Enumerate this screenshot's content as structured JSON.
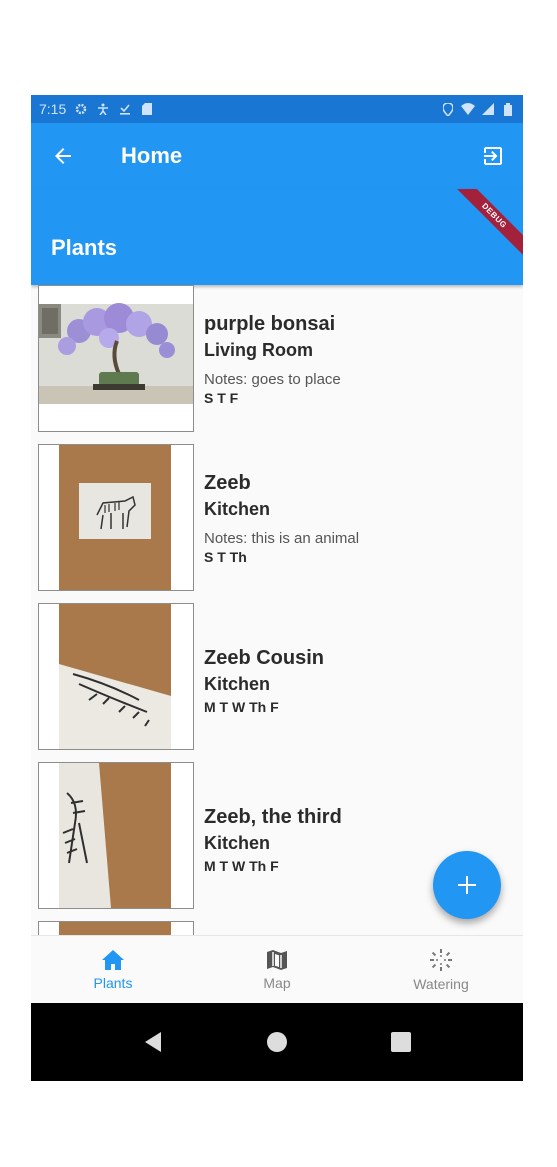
{
  "status_bar": {
    "time": "7:15",
    "icons": [
      "settings-icon",
      "accessibility-icon",
      "download-done-icon",
      "sd-card-icon",
      "location-icon",
      "wifi-icon",
      "signal-icon",
      "battery-icon"
    ]
  },
  "app_bar": {
    "title": "Home",
    "back_icon": "arrow-back-icon",
    "action_icon": "logout-icon"
  },
  "header": {
    "title": "Plants",
    "debug_label": "DEBUG"
  },
  "plants": [
    {
      "name": "purple bonsai",
      "room": "Living Room",
      "notes": "Notes: goes to place",
      "days": "S T F",
      "image": "bonsai-photo"
    },
    {
      "name": "Zeeb",
      "room": "Kitchen",
      "notes": "Notes: this is an animal",
      "days": "S T Th",
      "image": "zebra-drawing-photo"
    },
    {
      "name": "Zeeb Cousin",
      "room": "Kitchen",
      "notes": "",
      "days": "M T W Th F",
      "image": "zebra-drawing-photo"
    },
    {
      "name": "Zeeb, the third",
      "room": "Kitchen",
      "notes": "",
      "days": "M T W Th F",
      "image": "zebra-drawing-photo"
    }
  ],
  "fab": {
    "icon": "plus-icon"
  },
  "bottom_nav": {
    "items": [
      {
        "label": "Plants",
        "icon": "home-icon",
        "active": true
      },
      {
        "label": "Map",
        "icon": "map-icon",
        "active": false
      },
      {
        "label": "Watering",
        "icon": "sprinkler-icon",
        "active": false
      }
    ]
  },
  "colors": {
    "primary": "#2196f3",
    "primary_dark": "#1976d2",
    "debug_ribbon": "#a3213b",
    "inactive_nav": "#888888"
  }
}
